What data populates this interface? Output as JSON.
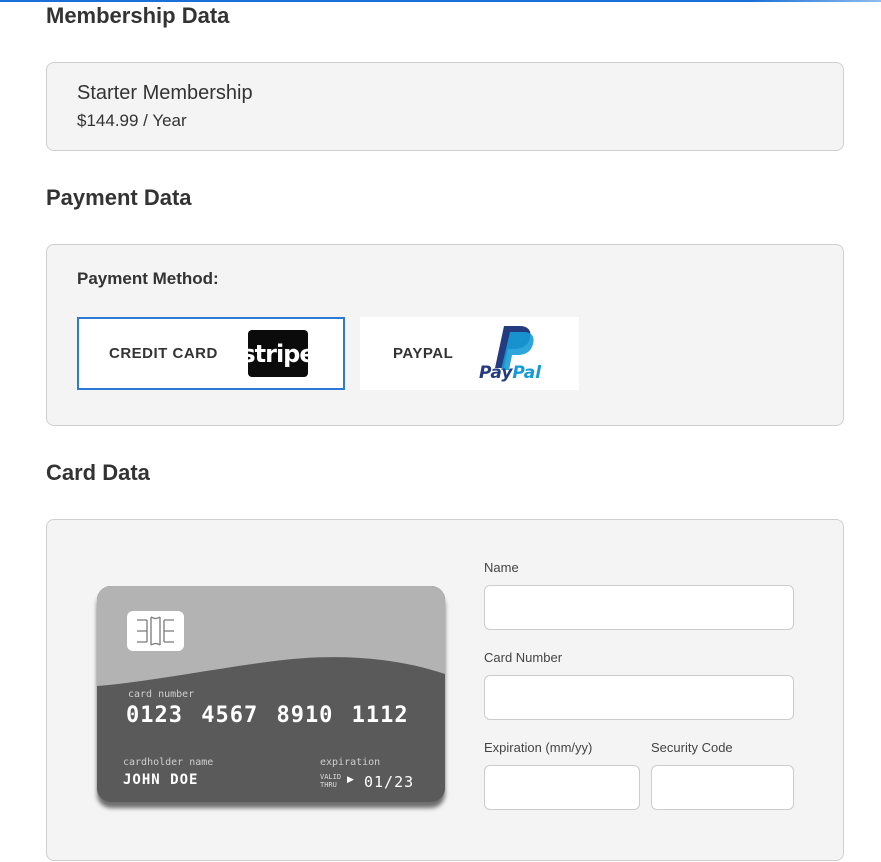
{
  "membership": {
    "heading": "Membership Data",
    "plan_name": "Starter Membership",
    "plan_price": "$144.99 / Year"
  },
  "payment": {
    "heading": "Payment Data",
    "method_label": "Payment Method:",
    "options": [
      {
        "label": "CREDIT CARD",
        "logo_text": "stripe",
        "selected": true
      },
      {
        "label": "PAYPAL",
        "logo_text_pay": "Pay",
        "logo_text_pal": "Pal",
        "selected": false
      }
    ],
    "selected_border_color": "#2d7ad6"
  },
  "card": {
    "heading": "Card Data",
    "preview": {
      "number_caption": "card number",
      "number": "0123 4567 8910 1112",
      "holder_caption": "cardholder name",
      "holder": "JOHN DOE",
      "exp_caption": "expiration",
      "valid_thru_1": "VALID",
      "valid_thru_2": "THRU",
      "arrow": "▶",
      "expiration": "01/23"
    },
    "fields": {
      "name_label": "Name",
      "name_value": "",
      "number_label": "Card Number",
      "number_value": "",
      "expiration_label": "Expiration (mm/yy)",
      "expiration_value": "",
      "security_label": "Security Code",
      "security_value": ""
    }
  },
  "colors": {
    "accent": "#2d7ad6",
    "panel_bg": "#f4f4f4",
    "card_dark": "#5a5a5a",
    "card_light": "#b3b3b3"
  }
}
